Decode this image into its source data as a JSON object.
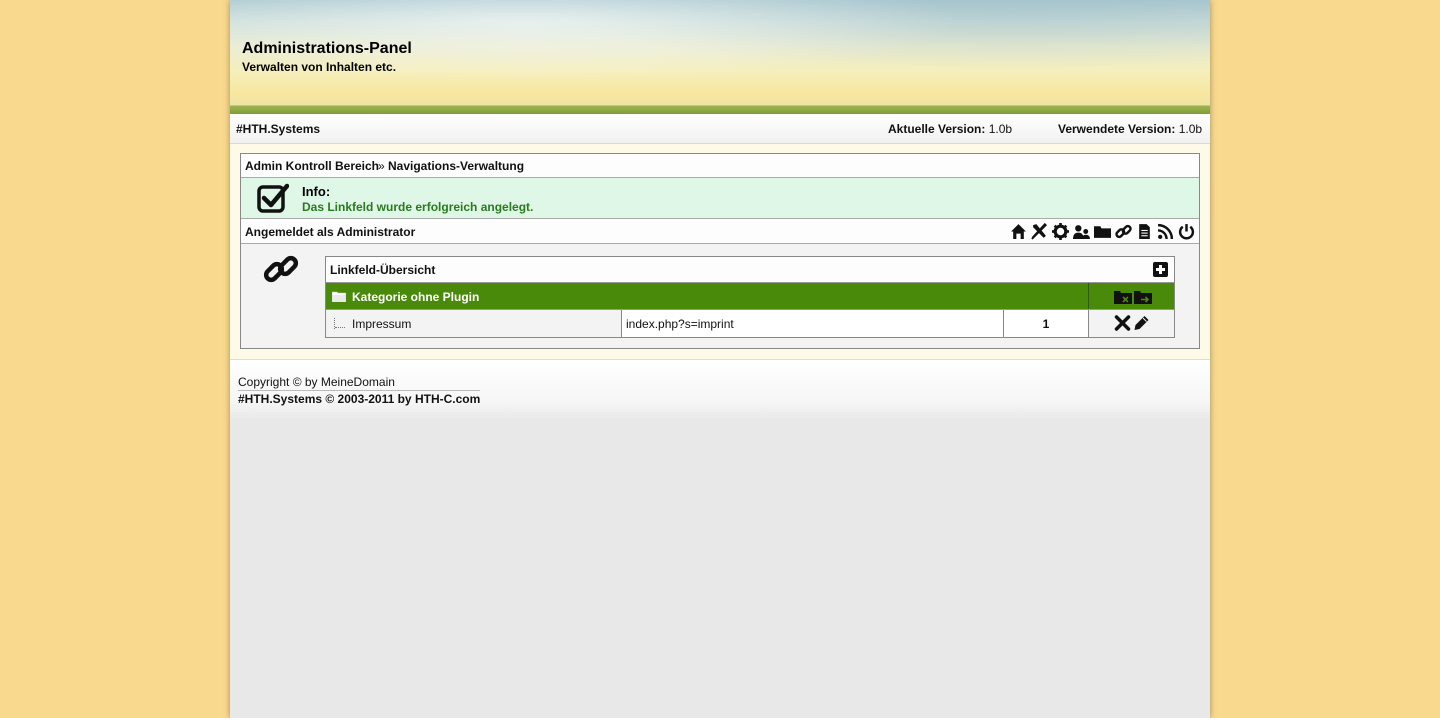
{
  "header": {
    "title": "Administrations-Panel",
    "subtitle": "Verwalten von Inhalten etc."
  },
  "version_bar": {
    "brand": "#HTH.Systems",
    "current_label": "Aktuelle Version:",
    "current_value": "1.0b",
    "used_label": "Verwendete Version:",
    "used_value": "1.0b"
  },
  "breadcrumb": {
    "root": "Admin Kontroll Bereich",
    "separator": "»",
    "current": "Navigations-Verwaltung"
  },
  "info": {
    "label": "Info:",
    "message": "Das Linkfeld wurde erfolgreich angelegt."
  },
  "session": {
    "logged_in_text": "Angemeldet als Administrator"
  },
  "toolbar": {
    "icons": [
      "home-icon",
      "tools-icon",
      "settings-icon",
      "users-icon",
      "folder-icon",
      "link-icon",
      "document-icon",
      "rss-icon",
      "power-icon"
    ]
  },
  "linkfield_table": {
    "title": "Linkfeld-Übersicht",
    "category": {
      "name": "Kategorie ohne Plugin",
      "action_icons": [
        "folder-delete-icon",
        "folder-move-icon"
      ]
    },
    "rows": [
      {
        "name": "Impressum",
        "url": "index.php?s=imprint",
        "position": "1",
        "action_icons": [
          "delete-icon",
          "edit-icon"
        ]
      }
    ]
  },
  "footer": {
    "copyright": "Copyright © by MeineDomain",
    "system": "#HTH.Systems © 2003-2011 by HTH-C.com"
  },
  "colors": {
    "page_background": "#f9d98d",
    "category_row": "#4a8a0a",
    "info_background": "#dff7e6",
    "info_text": "#2a7a20"
  }
}
